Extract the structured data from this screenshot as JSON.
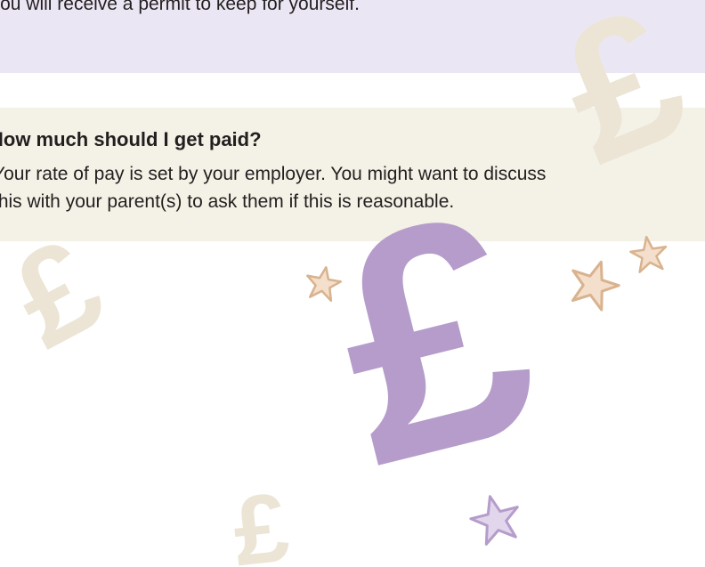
{
  "permit_section": {
    "text": "You will receive a permit to keep for yourself."
  },
  "pay_section": {
    "heading": "How much should I get paid?",
    "lines": [
      "Your rate of pay is set by your employer. You might want to discuss",
      "this with your parent(s) to ask them if this is reasonable."
    ]
  },
  "decorations": {
    "currency_symbol": "£",
    "icons": [
      "pound-sign-icon",
      "star-icon"
    ],
    "colors": {
      "purple_panel": "#ebe6f3",
      "beige_panel": "#f4f1e6",
      "large_pound": "#b59cca",
      "faded_pound": "#ece5d5",
      "star_tan": "#d9b28e",
      "star_purple": "#b59cca"
    }
  }
}
